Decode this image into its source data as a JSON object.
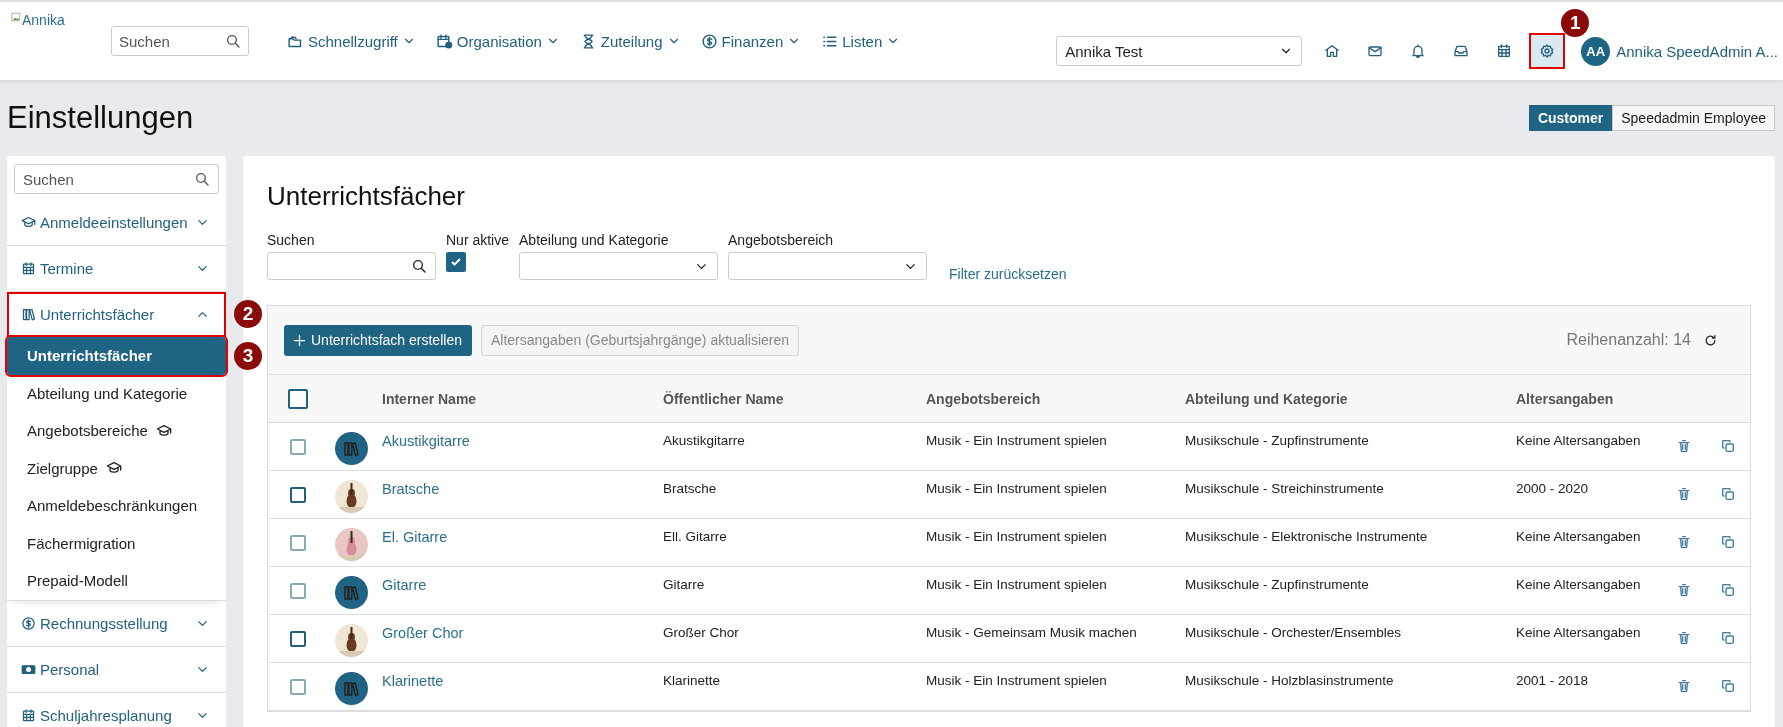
{
  "header": {
    "logo_alt": "Annika",
    "search": {
      "placeholder": "Suchen"
    },
    "nav": [
      {
        "label": "Schnellzugriff",
        "kind": "folders"
      },
      {
        "label": "Organisation",
        "kind": "calclock"
      },
      {
        "label": "Zuteilung",
        "kind": "hourglass"
      },
      {
        "label": "Finanzen",
        "kind": "dollar"
      },
      {
        "label": "Listen",
        "kind": "list"
      }
    ],
    "account_select": "Annika Test",
    "icons": [
      {
        "kind": "home",
        "selected": false
      },
      {
        "kind": "mail",
        "selected": false
      },
      {
        "kind": "bell",
        "selected": false
      },
      {
        "kind": "inbox",
        "selected": false
      },
      {
        "kind": "calendar",
        "selected": false
      },
      {
        "kind": "gear",
        "selected": true,
        "marker": "1"
      }
    ],
    "user": {
      "initials": "AA",
      "name": "Annika SpeedAdmin A..."
    }
  },
  "page_title": "Einstellungen",
  "view_toggle": [
    {
      "label": "Customer",
      "selected": true
    },
    {
      "label": "Speedadmin Employee",
      "selected": false
    }
  ],
  "sidebar": {
    "search": {
      "placeholder": "Suchen"
    },
    "sections": [
      {
        "label": "Anmeldeeinstellungen",
        "kind": "cap",
        "expanded": false
      },
      {
        "label": "Termine",
        "kind": "calendar",
        "expanded": false
      },
      {
        "label": "Unterrichtsfächer",
        "kind": "books",
        "expanded": true,
        "marker": "2",
        "children": [
          {
            "label": "Unterrichtsfächer",
            "selected": true,
            "kind": "plain",
            "marker": "3"
          },
          {
            "label": "Abteilung und Kategorie",
            "selected": false,
            "kind": "plain"
          },
          {
            "label": "Angebotsbereiche",
            "selected": false,
            "kind": "cap"
          },
          {
            "label": "Zielgruppe",
            "selected": false,
            "kind": "cap"
          },
          {
            "label": "Anmeldebeschränkungen",
            "selected": false,
            "kind": "plain"
          },
          {
            "label": "Fächermigration",
            "selected": false,
            "kind": "plain"
          },
          {
            "label": "Prepaid-Modell",
            "selected": false,
            "kind": "plain"
          }
        ]
      },
      {
        "label": "Rechnungsstellung",
        "kind": "dollar",
        "expanded": false
      },
      {
        "label": "Personal",
        "kind": "money",
        "expanded": false
      },
      {
        "label": "Schuljahresplanung",
        "kind": "calendar",
        "expanded": false
      }
    ]
  },
  "panel": {
    "title": "Unterrichtsfächer",
    "filters": {
      "search_label": "Suchen",
      "active_label": "Nur aktive",
      "active_checked": true,
      "department_label": "Abteilung und Kategorie",
      "area_label": "Angebotsbereich",
      "reset_link": "Filter zurücksetzen"
    },
    "create_button": "Unterrichtsfach erstellen",
    "update_button": {
      "label": "Altersangaben (Geburtsjahrgänge) aktualisieren",
      "disabled": true
    },
    "row_count": "Reihenanzahl: 14",
    "select_all_checked": false,
    "columns": [
      "Interner Name",
      "Öffentlicher Name",
      "Angebotsbereich",
      "Abteilung und Kategorie",
      "Altersangaben"
    ],
    "rows": [
      {
        "checked": false,
        "kind": "books",
        "internal_name": "Akustikgitarre",
        "public_name": "Akustikgitarre",
        "area": "Musik - Ein Instrument spielen",
        "department": "Musikschule - Zupfinstrumente",
        "ages": "Keine Altersangaben"
      },
      {
        "checked": false,
        "kind": "picture",
        "internal_name": "Bratsche",
        "public_name": "Bratsche",
        "area": "Musik - Ein Instrument spielen",
        "department": "Musikschule - Streichinstrumente",
        "ages": "2000 - 2020"
      },
      {
        "checked": false,
        "kind": "picture",
        "internal_name": "El. Gitarre",
        "public_name": "Ell. Gitarre",
        "area": "Musik - Ein Instrument spielen",
        "department": "Musikschule - Elektronische Instrumente",
        "ages": "Keine Altersangaben"
      },
      {
        "checked": false,
        "kind": "books",
        "internal_name": "Gitarre",
        "public_name": "Gitarre",
        "area": "Musik - Ein Instrument spielen",
        "department": "Musikschule - Zupfinstrumente",
        "ages": "Keine Altersangaben"
      },
      {
        "checked": false,
        "kind": "picture",
        "internal_name": "Großer Chor",
        "public_name": "Großer Chor",
        "area": "Musik - Gemeinsam Musik machen",
        "department": "Musikschule - Orchester/Ensembles",
        "ages": "Keine Altersangaben"
      },
      {
        "checked": false,
        "kind": "books",
        "internal_name": "Klarinette",
        "public_name": "Klarinette",
        "area": "Musik - Ein Instrument spielen",
        "department": "Musikschule - Holzblasinstrumente",
        "ages": "2001 - 2018"
      }
    ]
  }
}
